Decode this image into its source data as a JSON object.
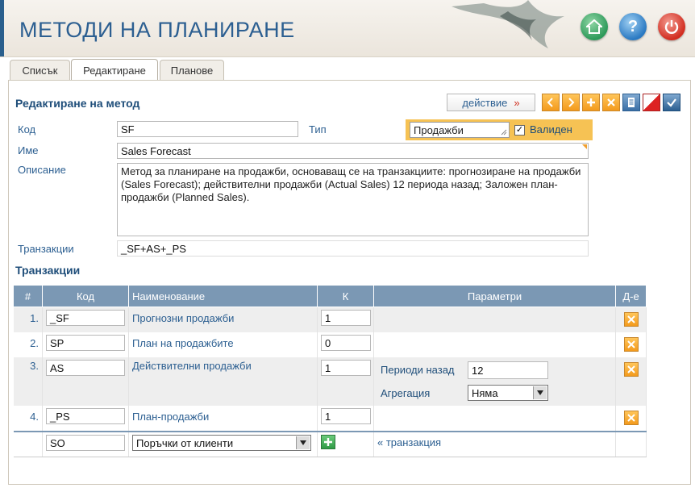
{
  "header": {
    "title": "МЕТОДИ НА ПЛАНИРАНЕ"
  },
  "header_icons": [
    "home-icon",
    "help-icon",
    "power-icon"
  ],
  "help_glyph": "?",
  "tabs": [
    {
      "label": "Списък",
      "active": false
    },
    {
      "label": "Редактиране",
      "active": true
    },
    {
      "label": "Планове",
      "active": false
    }
  ],
  "form": {
    "section_title": "Редактиране на метод",
    "action_label": "действие",
    "action_arrow": "»",
    "toolbar_icons": [
      "arrow-left-icon",
      "arrow-right-icon",
      "plus-icon",
      "close-icon",
      "print-icon",
      "clear-icon",
      "check-icon"
    ],
    "code_label": "Код",
    "code_value": "SF",
    "type_label": "Тип",
    "type_value": "Продажби",
    "valid_label": "Валиден",
    "valid_checked": true,
    "name_label": "Име",
    "name_value": "Sales Forecast",
    "desc_label": "Описание",
    "desc_value": "Метод за планиране на продажби, основаващ се на транзакциите: прогнозиране на продажби (Sales Forecast); действителни продажби (Actual Sales) 12 периода назад; Заложен план-продажби (Planned Sales).",
    "trans_label": "Транзакции",
    "trans_value": "_SF+AS+_PS"
  },
  "transactions": {
    "section_title": "Транзакции",
    "columns": [
      "#",
      "Код",
      "Наименование",
      "К",
      "Параметри",
      "Д-е"
    ],
    "rows": [
      {
        "num": "1.",
        "code": "_SF",
        "name": "Прогнозни продажби",
        "k": "1"
      },
      {
        "num": "2.",
        "code": "SP",
        "name": "План на продажбите",
        "k": "0"
      },
      {
        "num": "3.",
        "code": "AS",
        "name": "Действителни продажби",
        "k": "1",
        "params": {
          "periods_label": "Периоди назад",
          "periods_value": "12",
          "agg_label": "Агрегация",
          "agg_value": "Няма"
        }
      },
      {
        "num": "4.",
        "code": "_PS",
        "name": "План-продажби",
        "k": "1"
      }
    ],
    "new_row": {
      "code": "SO",
      "select_value": "Поръчки от клиенти",
      "add_link": "« транзакция"
    }
  },
  "colors": {
    "accent": "#2c5f91",
    "header_bg": "#7b98b4",
    "orange": "#f39a1c",
    "valid_bg": "#f6c254"
  }
}
